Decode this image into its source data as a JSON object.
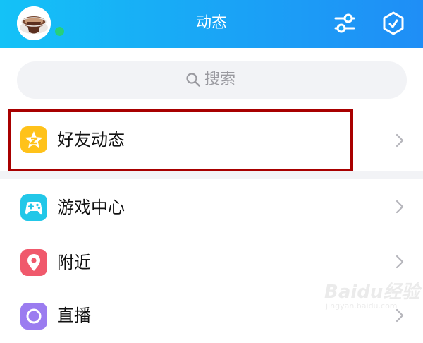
{
  "header": {
    "title": "动态",
    "bg_from": "#14c2f7",
    "bg_to": "#1f8ef6",
    "online_dot_color": "#27d07a",
    "buttons": [
      "filter-sliders-icon",
      "hexagon-check-icon"
    ]
  },
  "search": {
    "placeholder": "搜索",
    "icon": "search-icon"
  },
  "menu": [
    {
      "label": "好友动态",
      "icon": "star-qzone-icon",
      "icon_color": "#ffc21a",
      "highlighted": true
    },
    {
      "label": "游戏中心",
      "icon": "gamepad-icon",
      "icon_color": "#22c7e8"
    },
    {
      "label": "附近",
      "icon": "location-pin-icon",
      "icon_color": "#f0596c"
    },
    {
      "label": "直播",
      "icon": "live-icon",
      "icon_color": "#9b7cf0"
    }
  ],
  "highlight_color": "#a80000",
  "watermark": {
    "text": "Baidu经验",
    "url": "jingyan.baidu.com"
  }
}
